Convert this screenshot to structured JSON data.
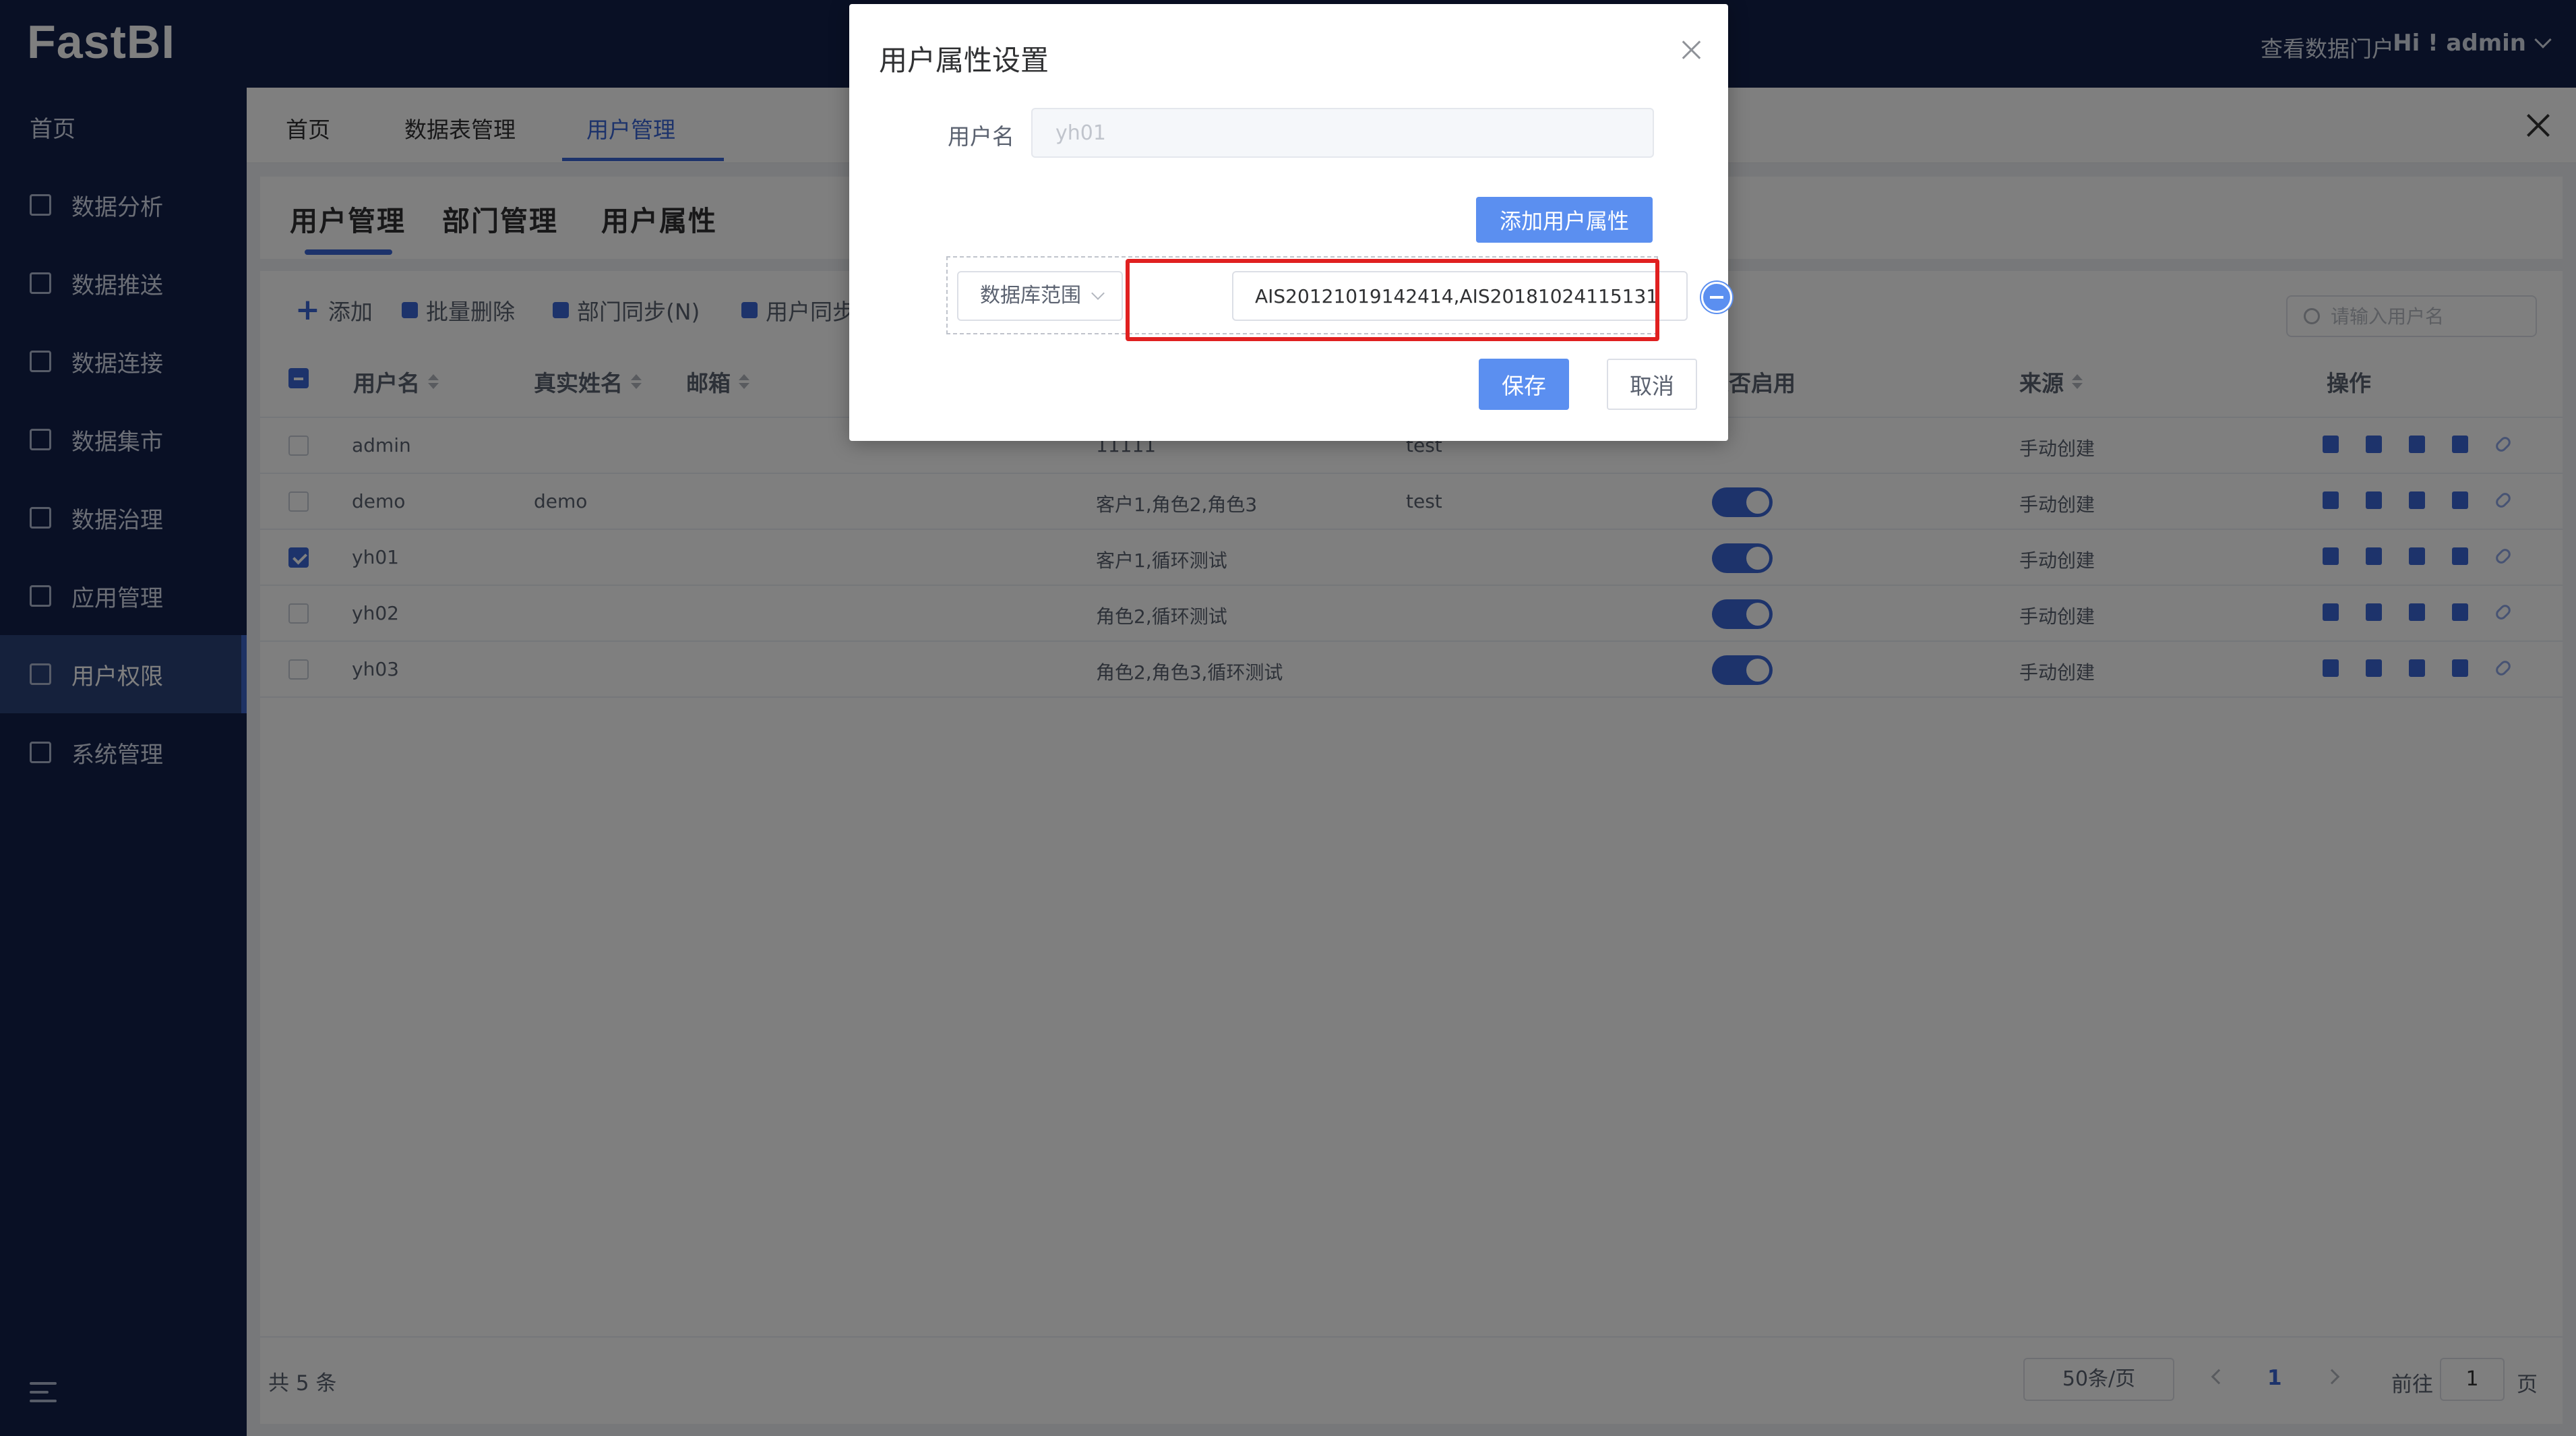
{
  "app": {
    "logo": "FastBI",
    "portal_link": "查看数据门户",
    "greeting": "Hi ! admin"
  },
  "sidebar": {
    "items": [
      {
        "label": "首页",
        "icon": "home"
      },
      {
        "label": "数据分析",
        "icon": "chart-icon"
      },
      {
        "label": "数据推送",
        "icon": "bar-chart-icon"
      },
      {
        "label": "数据连接",
        "icon": "connect-icon"
      },
      {
        "label": "数据集市",
        "icon": "monitor-icon"
      },
      {
        "label": "数据治理",
        "icon": "layers-icon"
      },
      {
        "label": "应用管理",
        "icon": "grid-icon"
      },
      {
        "label": "用户权限",
        "icon": "user-permission-icon",
        "active": true
      },
      {
        "label": "系统管理",
        "icon": "settings-icon"
      }
    ]
  },
  "tabs": [
    {
      "label": "首页"
    },
    {
      "label": "数据表管理"
    },
    {
      "label": "用户管理",
      "active": true
    }
  ],
  "subtabs": [
    {
      "label": "用户管理",
      "active": true
    },
    {
      "label": "部门管理"
    },
    {
      "label": "用户属性"
    }
  ],
  "toolbar": {
    "add": "添加",
    "batch_delete": "批量删除",
    "dept_sync": "部门同步(N)",
    "user_sync": "用户同步"
  },
  "search": {
    "placeholder": "请输入用户名"
  },
  "table": {
    "headers": {
      "username": "用户名",
      "realname": "真实姓名",
      "email": "邮箱",
      "enabled": "是否启用",
      "source": "来源",
      "actions": "操作"
    },
    "rows": [
      {
        "username": "admin",
        "realname": "",
        "roles": "11111",
        "dept": "test",
        "enabled": null,
        "source": "手动创建",
        "checked": false
      },
      {
        "username": "demo",
        "realname": "demo",
        "roles": "客户1,角色2,角色3",
        "dept": "test",
        "enabled": true,
        "source": "手动创建",
        "checked": false
      },
      {
        "username": "yh01",
        "realname": "",
        "roles": "客户1,循环测试",
        "dept": "",
        "enabled": true,
        "source": "手动创建",
        "checked": true
      },
      {
        "username": "yh02",
        "realname": "",
        "roles": "角色2,循环测试",
        "dept": "",
        "enabled": true,
        "source": "手动创建",
        "checked": false
      },
      {
        "username": "yh03",
        "realname": "",
        "roles": "角色2,角色3,循环测试",
        "dept": "",
        "enabled": true,
        "source": "手动创建",
        "checked": false
      }
    ]
  },
  "pagination": {
    "total": "共 5 条",
    "page_size": "50条/页",
    "current": "1",
    "goto_label": "前往",
    "goto_value": "1",
    "page_unit": "页"
  },
  "dialog": {
    "title": "用户属性设置",
    "username_label": "用户名",
    "username_value": "yh01",
    "add_attr_button": "添加用户属性",
    "attr_select": "数据库范围",
    "attr_value": "AIS20121019142414,AIS20181024115131",
    "save": "保存",
    "cancel": "取消"
  },
  "colors": {
    "accent": "#3b66d6",
    "dialog_button": "#5b8ff0",
    "highlight": "#e02020",
    "sidebar_bg": "#13214a"
  }
}
